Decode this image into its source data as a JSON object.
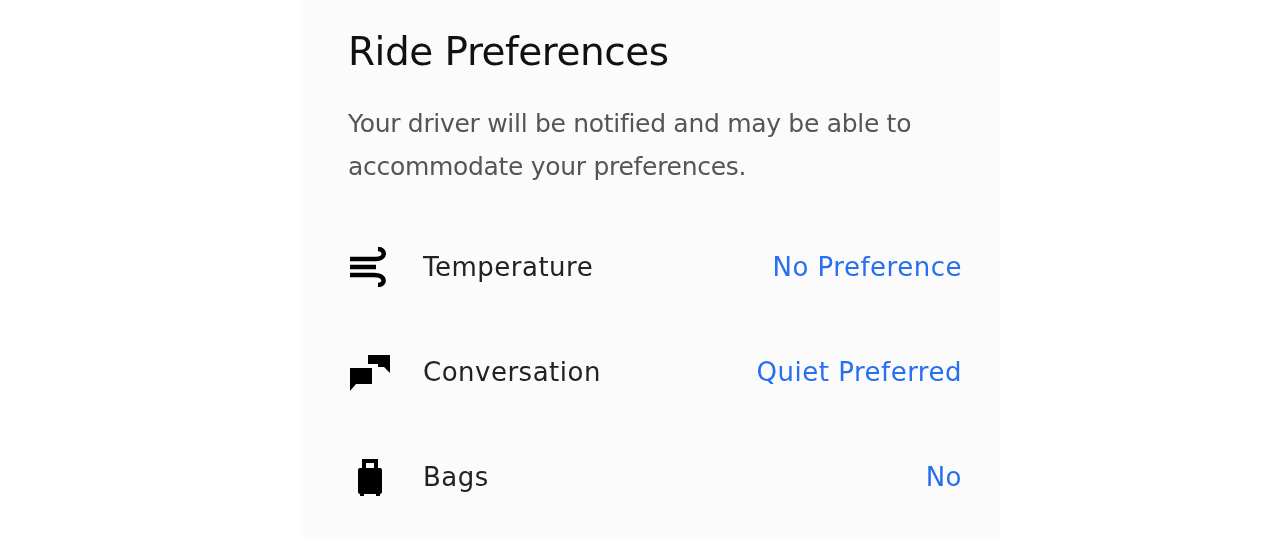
{
  "title": "Ride Preferences",
  "description": "Your driver will be notified and may be able to accommodate your preferences.",
  "preferences": [
    {
      "label": "Temperature",
      "value": "No Preference"
    },
    {
      "label": "Conversation",
      "value": "Quiet Preferred"
    },
    {
      "label": "Bags",
      "value": "No"
    }
  ]
}
